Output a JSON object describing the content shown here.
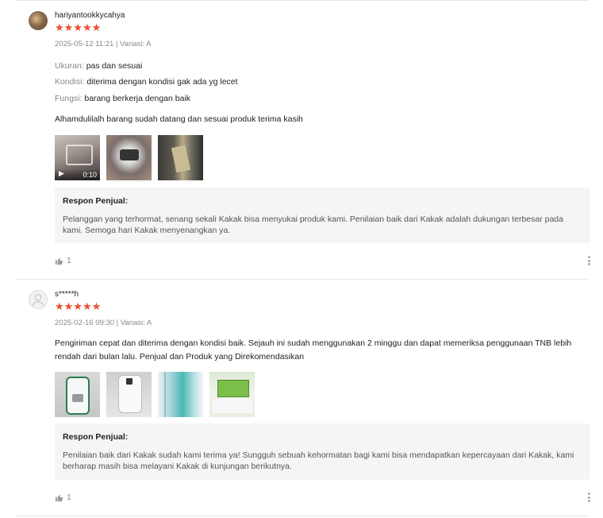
{
  "reviews": [
    {
      "username": "hariyantookkycahya",
      "stars": "★★★★★",
      "rating": 5,
      "meta": "2025-05-12 11:21 | Variasi: A",
      "attributes": [
        {
          "key": "Ukuran:",
          "value": "pas dan sesuai"
        },
        {
          "key": "Kondisi:",
          "value": "diterima dengan kondisi gak ada yg lecet"
        },
        {
          "key": "Fungsi:",
          "value": "barang berkerja dengan baik"
        }
      ],
      "comment": "Alhamdulilalh barang sudah datang dan sesuai produk terima kasih",
      "video_duration": "0:10",
      "seller_title": "Respon Penjual:",
      "seller_text": "Pelanggan yang terhormat, senang sekali Kakak bisa menyukai produk kami. Penilaian baik dari Kakak adalah dukungan terbesar pada kami. Semoga hari Kakak menyenangkan ya.",
      "likes": "1"
    },
    {
      "username": "s*****h",
      "stars": "★★★★★",
      "rating": 5,
      "meta": "2025-02-16 09:30 | Variasi: A",
      "comment": "Pengiriman cepat dan diterima dengan kondisi baik. Sejauh ini sudah menggunakan 2 minggu dan dapat memeriksa penggunaan TNB lebih rendah dari bulan lalu. Penjual dan Produk yang Direkomendasikan",
      "seller_title": "Respon Penjual:",
      "seller_text": "Penilaian baik dari Kakak sudah kami terima ya! Sungguh sebuah kehormatan bagi kami bisa mendapatkan kepercayaan dari Kakak, kami berharap masih bisa melayani Kakak di kunjungan berikutnya.",
      "likes": "1"
    }
  ],
  "colors": {
    "star": "#ee4d2d",
    "seller_bg": "#f5f5f5",
    "muted": "#888888"
  },
  "icons": [
    "thumbs-up-icon",
    "more-vertical-icon",
    "video-camera-icon",
    "user-icon"
  ]
}
